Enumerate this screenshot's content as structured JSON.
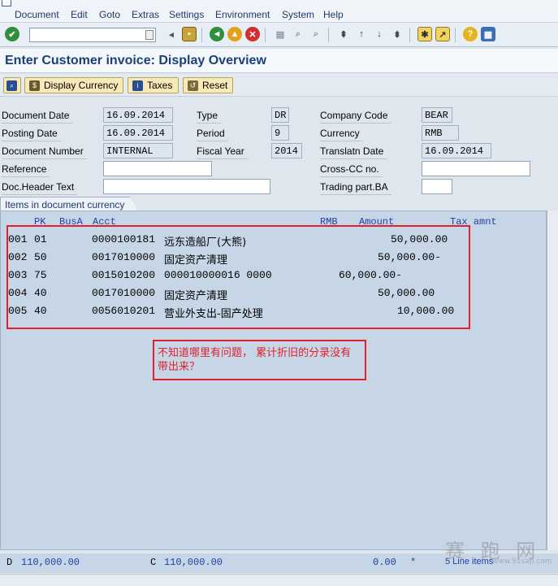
{
  "menu": [
    "Document",
    "Edit",
    "Goto",
    "Extras",
    "Settings",
    "Environment",
    "System",
    "Help"
  ],
  "title": "Enter Customer invoice: Display Overview",
  "app_toolbar": {
    "display_currency": "Display Currency",
    "taxes": "Taxes",
    "reset": "Reset"
  },
  "header": {
    "document_date_label": "Document Date",
    "document_date": "16.09.2014",
    "posting_date_label": "Posting Date",
    "posting_date": "16.09.2014",
    "document_number_label": "Document Number",
    "document_number": "INTERNAL",
    "reference_label": "Reference",
    "reference": "",
    "doc_header_text_label": "Doc.Header Text",
    "doc_header_text": "",
    "type_label": "Type",
    "type": "DR",
    "period_label": "Period",
    "period": "9",
    "fiscal_year_label": "Fiscal Year",
    "fiscal_year": "2014",
    "company_code_label": "Company Code",
    "company_code": "BEAR",
    "currency_label": "Currency",
    "currency": "RMB",
    "translatn_date_label": "Translatn Date",
    "translatn_date": "16.09.2014",
    "cross_cc_label": "Cross-CC no.",
    "cross_cc": "",
    "trading_part_label": "Trading part.BA",
    "trading_part": ""
  },
  "items": {
    "tab_label": "Items in document currency",
    "columns": [
      "PK",
      "BusA",
      "Acct",
      "RMB",
      "Amount",
      "Tax amnt"
    ],
    "rows": [
      {
        "no": "001",
        "pk": "01",
        "acct": "0000100181",
        "text": "远东造船厂(大熊)",
        "amount": "50,000.00"
      },
      {
        "no": "002",
        "pk": "50",
        "acct": "0017010000",
        "text": "固定资产清理",
        "amount": "50,000.00-"
      },
      {
        "no": "003",
        "pk": "75",
        "acct": "0015010200",
        "text": "000010000016 0000",
        "amount": "60,000.00-"
      },
      {
        "no": "004",
        "pk": "40",
        "acct": "0017010000",
        "text": "固定资产清理",
        "amount": "50,000.00"
      },
      {
        "no": "005",
        "pk": "40",
        "acct": "0056010201",
        "text": "营业外支出-固产处理",
        "amount": "10,000.00"
      }
    ]
  },
  "note": "不知道哪里有问题，  累计折旧的分录没有带出来？",
  "footer": {
    "d_label": "D",
    "d_value": "110,000.00",
    "c_label": "C",
    "c_value": "110,000.00",
    "diff_value": "0.00",
    "star": "*",
    "line_items": "5 Line items"
  },
  "watermark": {
    "big": "赛 跑 网",
    "small": "www.91sap.com"
  }
}
